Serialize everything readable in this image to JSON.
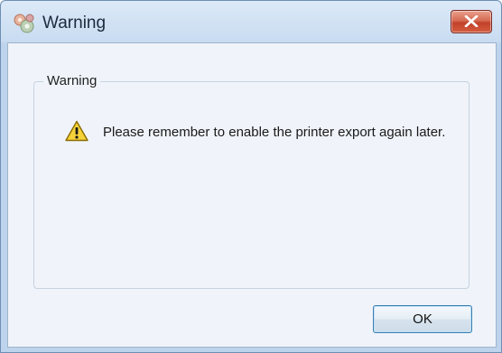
{
  "window": {
    "title": "Warning",
    "icon": "app-gears-icon",
    "close_icon": "close-icon"
  },
  "group": {
    "legend": "Warning"
  },
  "content": {
    "icon": "warning-triangle-icon",
    "message": "Please remember to enable the printer export again later."
  },
  "buttons": {
    "ok_label": "OK"
  },
  "colors": {
    "close_button": "#c2412a",
    "client_bg": "#f0f4fa",
    "ok_border": "#3c7fb1",
    "warning_yellow": "#f6d23a"
  }
}
